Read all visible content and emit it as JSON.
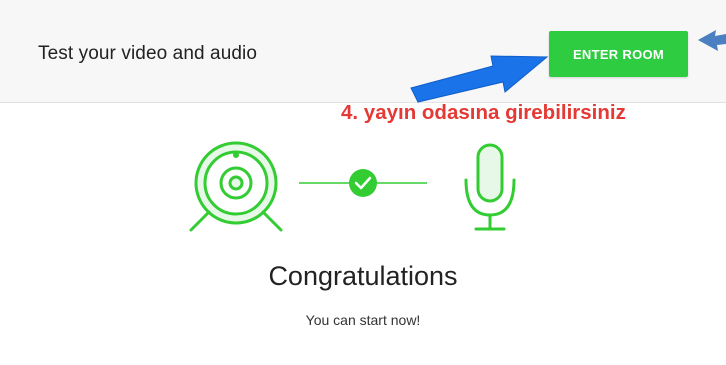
{
  "header": {
    "title": "Test your video and audio",
    "enter_button_label": "ENTER ROOM"
  },
  "annotation": {
    "text": "4. yayın odasına girebilirsiniz"
  },
  "result": {
    "title": "Congratulations",
    "subtitle": "You can start now!"
  },
  "icons": {
    "camera": "webcam-icon",
    "check": "check-circle-icon",
    "microphone": "microphone-icon",
    "arrow_main": "arrow-annotation",
    "arrow_side": "arrow-annotation-side"
  },
  "colors": {
    "accent_green": "#2ecc40",
    "icon_green": "#33cc33",
    "annotation_red": "#e53935",
    "arrow_blue": "#1a73e8",
    "arrow_side_blue": "#4a7fc1",
    "header_bg": "#f7f7f7"
  }
}
